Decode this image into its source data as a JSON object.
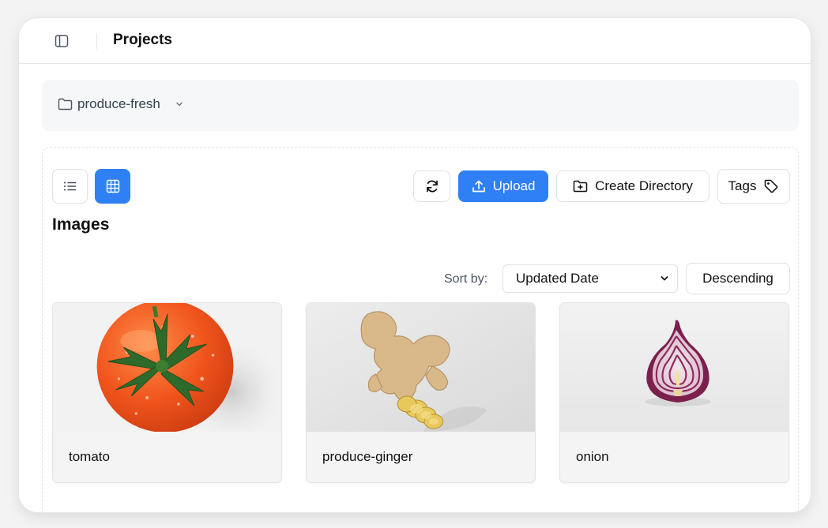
{
  "header": {
    "title": "Projects"
  },
  "project": {
    "name": "produce-fresh"
  },
  "toolbar": {
    "upload_label": "Upload",
    "create_directory_label": "Create Directory",
    "tags_label": "Tags"
  },
  "section": {
    "title": "Images"
  },
  "sort": {
    "label": "Sort by:",
    "selected": "Updated Date",
    "order_label": "Descending"
  },
  "images": [
    {
      "name": "tomato"
    },
    {
      "name": "produce-ginger"
    },
    {
      "name": "onion"
    }
  ],
  "colors": {
    "accent": "#2f80f5"
  }
}
